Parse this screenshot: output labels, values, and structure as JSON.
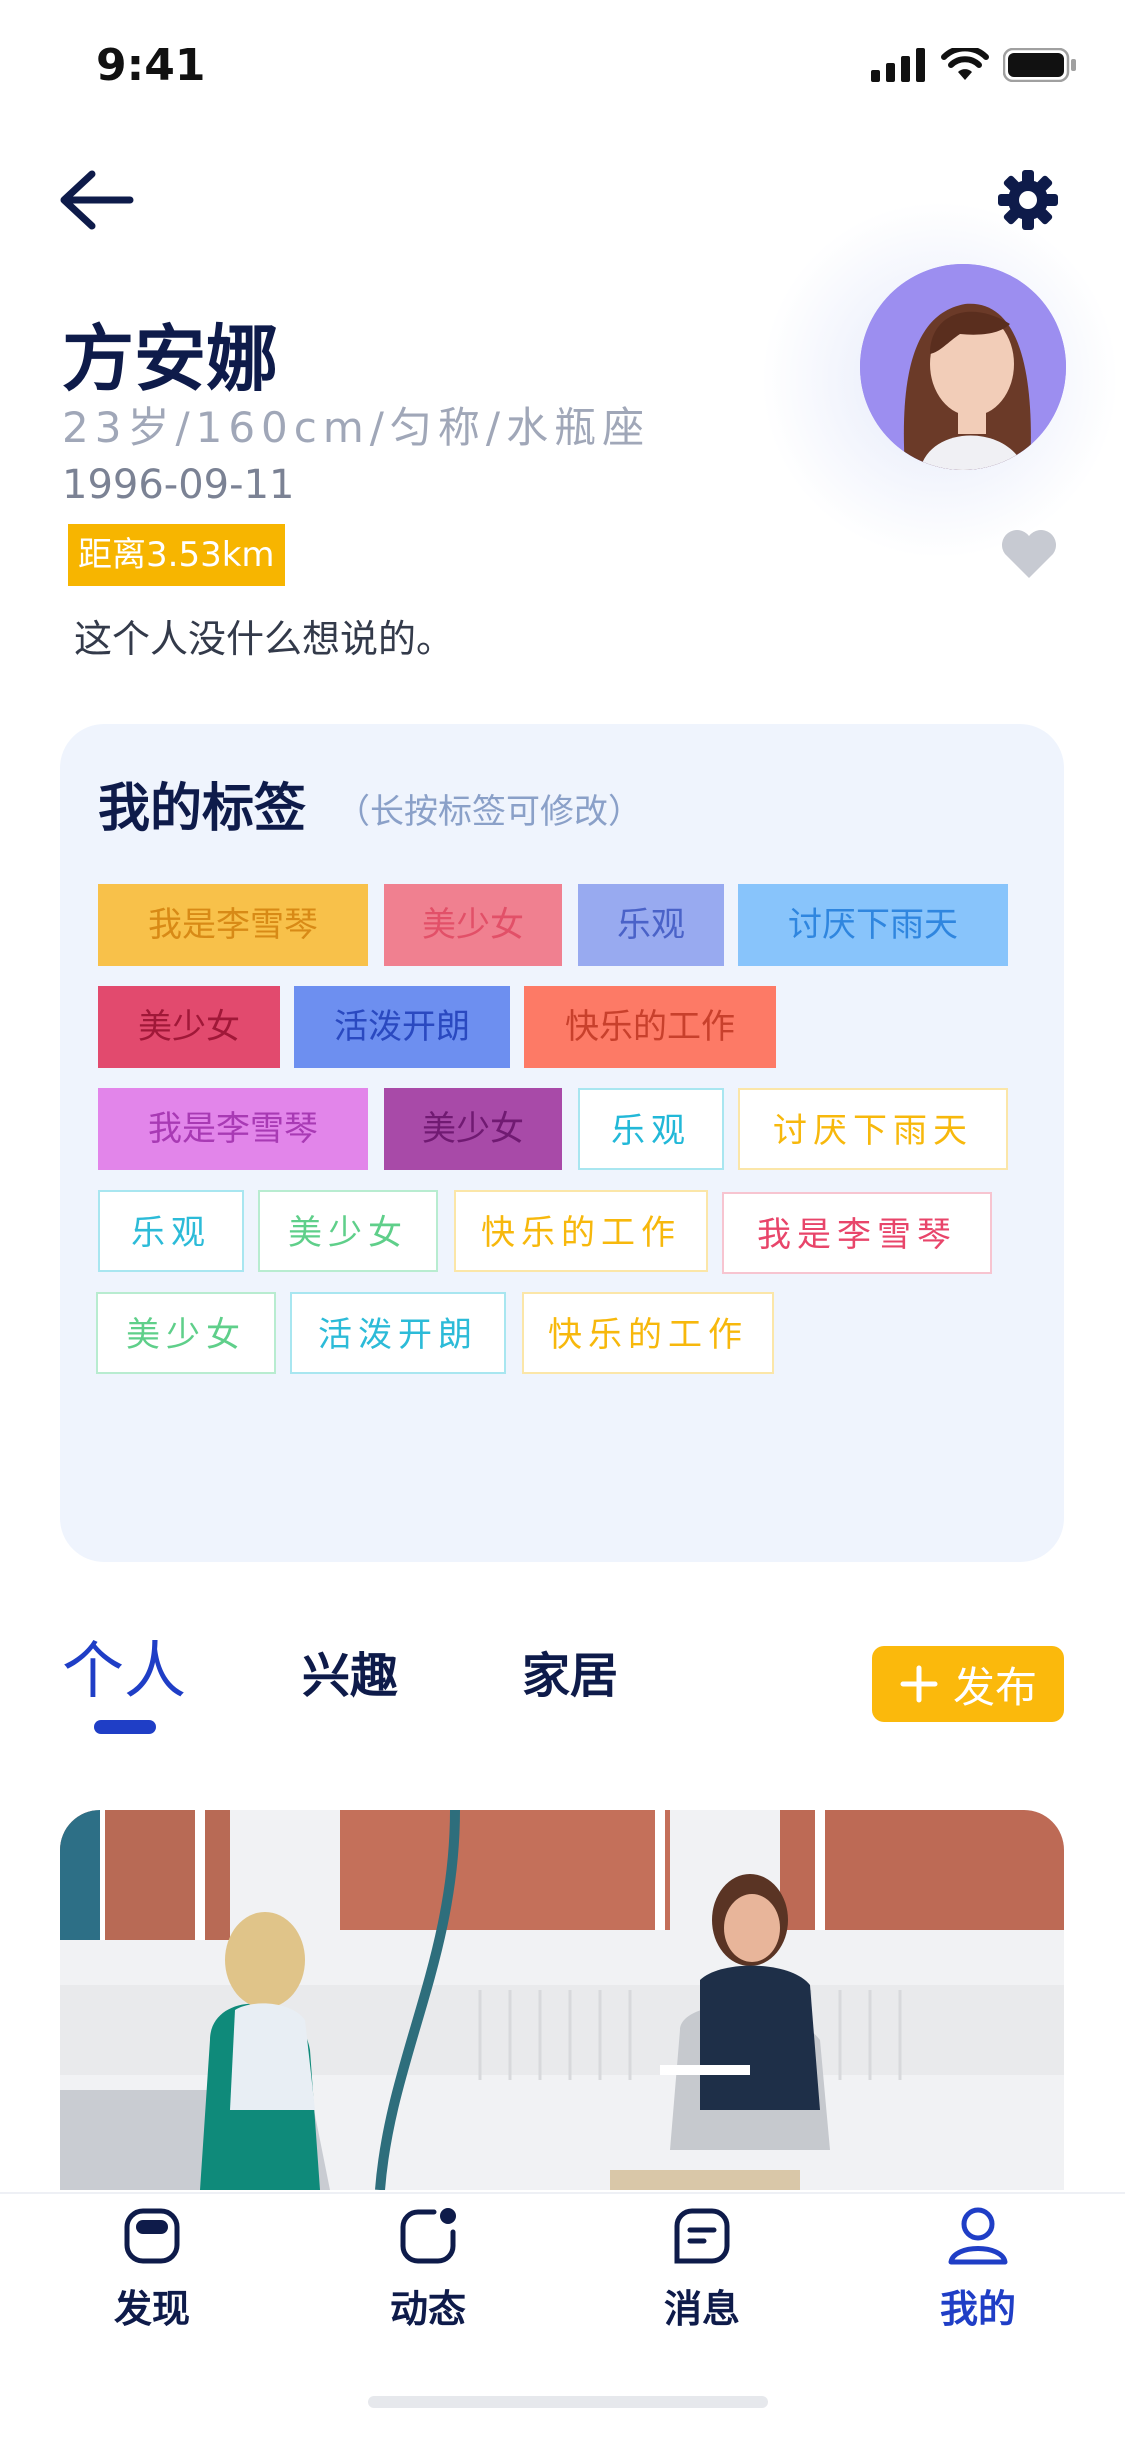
{
  "status_bar": {
    "time": "9:41"
  },
  "profile": {
    "name": "方安娜",
    "meta": "23岁/160cm/匀称/水瓶座",
    "birthday": "1996-09-11",
    "distance": "距离3.53km",
    "bio": "这个人没什么想说的。"
  },
  "tags_section": {
    "title": "我的标签",
    "hint": "（长按标签可修改）",
    "tags": [
      {
        "label": "我是李雪琴",
        "bg": "#f8c14a",
        "fg": "#d88a16"
      },
      {
        "label": "美少女",
        "bg": "#f08090",
        "fg": "#e25068"
      },
      {
        "label": "乐观",
        "bg": "#98aaf0",
        "fg": "#4a62c8"
      },
      {
        "label": "讨厌下雨天",
        "bg": "#88c4fb",
        "fg": "#2f86df"
      },
      {
        "label": "美少女",
        "bg": "#e24a6e",
        "fg": "#a01838"
      },
      {
        "label": "活泼开朗",
        "bg": "#6d8ff0",
        "fg": "#2a49c0"
      },
      {
        "label": "快乐的工作",
        "bg": "#fd7a66",
        "fg": "#c8402c"
      },
      {
        "label": "我是李雪琴",
        "bg": "#e285ea",
        "fg": "#a83ab4"
      },
      {
        "label": "美少女",
        "bg": "#a84aa8",
        "fg": "#701a72"
      },
      {
        "label": "乐观",
        "bg": "#ffffff",
        "fg": "#22b8d8",
        "border": "#a8e6f0"
      },
      {
        "label": "讨厌下雨天",
        "bg": "#ffffff",
        "fg": "#f7b80c",
        "border": "#fbe6a8"
      },
      {
        "label": "乐观",
        "bg": "#ffffff",
        "fg": "#2cbbd8",
        "border": "#a8e6f0"
      },
      {
        "label": "美少女",
        "bg": "#ffffff",
        "fg": "#5fcf8a",
        "border": "#b8ecd0"
      },
      {
        "label": "快乐的工作",
        "bg": "#ffffff",
        "fg": "#f7b80c",
        "border": "#fbe6a8"
      },
      {
        "label": "我是李雪琴",
        "bg": "#ffffff",
        "fg": "#e8456a",
        "border": "#f7c4d0"
      },
      {
        "label": "美少女",
        "bg": "#ffffff",
        "fg": "#5fcf8a",
        "border": "#b8ecd0"
      },
      {
        "label": "活泼开朗",
        "bg": "#ffffff",
        "fg": "#2cbbd8",
        "border": "#a8e6f0"
      },
      {
        "label": "快乐的工作",
        "bg": "#ffffff",
        "fg": "#f7b80c",
        "border": "#fbe6a8"
      }
    ]
  },
  "tabs": [
    {
      "label": "个人",
      "active": true
    },
    {
      "label": "兴趣",
      "active": false
    },
    {
      "label": "家居",
      "active": false
    }
  ],
  "publish_button": {
    "label": "发布",
    "icon": "plus-icon"
  },
  "bottom_nav": [
    {
      "label": "发现",
      "icon": "discover-icon",
      "active": false
    },
    {
      "label": "动态",
      "icon": "moments-icon",
      "active": false
    },
    {
      "label": "消息",
      "icon": "message-icon",
      "active": false
    },
    {
      "label": "我的",
      "icon": "user-icon",
      "active": true
    }
  ],
  "colors": {
    "primary": "#1f3ec6",
    "accent": "#f7b500",
    "card_bg": "#eff4fd",
    "dark_text": "#0e1b4a"
  }
}
